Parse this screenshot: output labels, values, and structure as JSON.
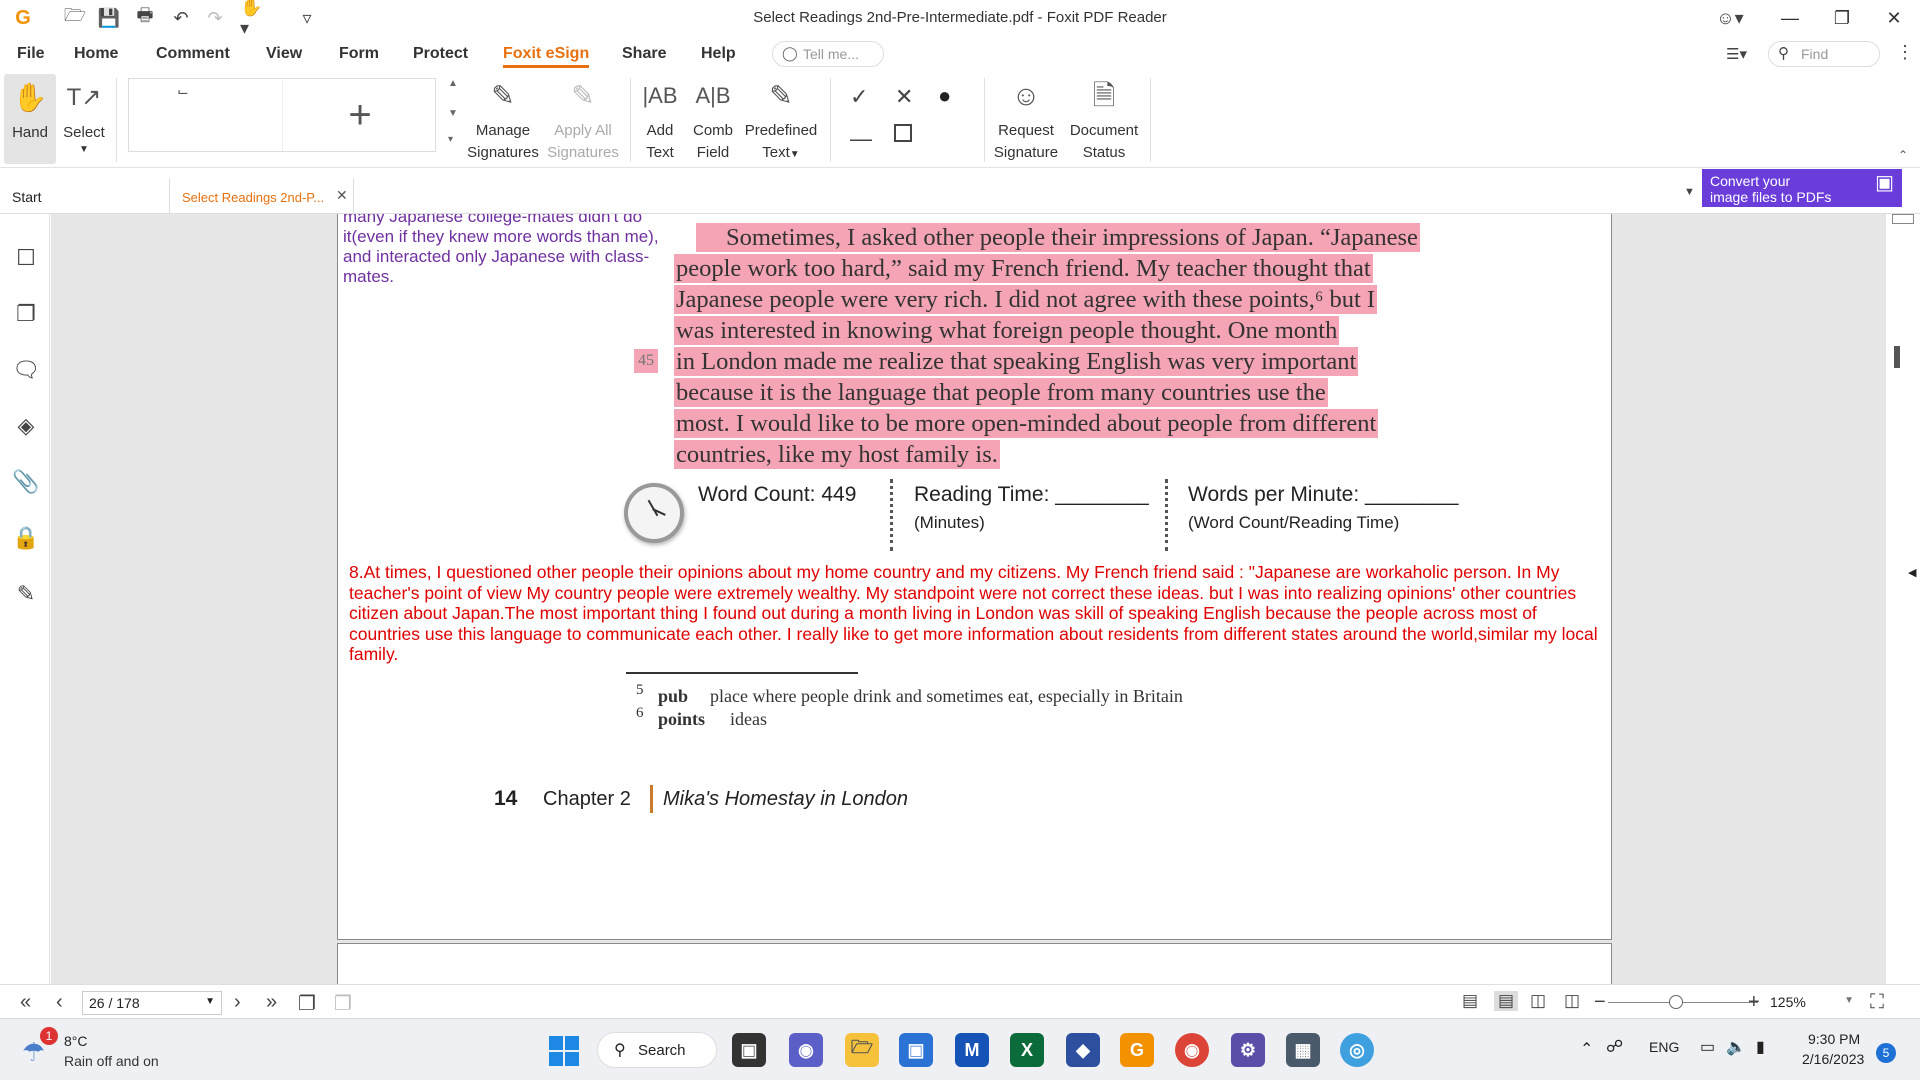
{
  "window": {
    "title": "Select Readings 2nd-Pre-Intermediate.pdf - Foxit PDF Reader",
    "minimize_icon": "minimize",
    "maximize_icon": "restore",
    "close_icon": "close"
  },
  "menu": {
    "items": [
      "File",
      "Home",
      "Comment",
      "View",
      "Form",
      "Protect",
      "Foxit eSign",
      "Share",
      "Help"
    ],
    "active": "Foxit eSign",
    "tell_me_placeholder": "Tell me...",
    "find_placeholder": "Find"
  },
  "ribbon": {
    "hand": "Hand",
    "select": "Select",
    "manage_signatures": [
      "Manage",
      "Signatures"
    ],
    "apply_all_signatures": [
      "Apply All",
      "Signatures"
    ],
    "add_text": [
      "Add",
      "Text"
    ],
    "comb_field": [
      "Comb",
      "Field"
    ],
    "predefined_text": [
      "Predefined",
      "Text"
    ],
    "request_signature": [
      "Request",
      "Signature"
    ],
    "document_status": [
      "Document",
      "Status"
    ],
    "add_symbol": "+"
  },
  "tabs": {
    "start": "Start",
    "document": "Select Readings 2nd-P...",
    "promo": [
      "Convert your",
      "image files to PDFs"
    ]
  },
  "document": {
    "purple_note": "many Japanese college-mates didn't do it(even if they knew more words than me), and interacted only Japanese with class-mates.",
    "highlighted_lines": [
      "Sometimes, I asked other people their impressions of Japan. “Japanese",
      "people work too hard,” said my French friend. My teacher thought that",
      "Japanese people were very rich. I did not agree with these points,⁶ but I",
      "was interested in knowing what foreign people thought. One month",
      "in London made me realize that speaking English was very important",
      "because it is the language that people from many countries use the",
      "most. I would like to be more open-minded about people from different",
      "countries, like my host family is."
    ],
    "line_number": "45",
    "word_count": "Word Count: 449",
    "reading_time": "Reading Time: ________",
    "reading_time_unit": "(Minutes)",
    "words_per_minute": "Words per Minute: ________",
    "wpm_formula": "(Word Count/Reading Time)",
    "red_note": "8.At times, I questioned other people their opinions about my home country and my citizens. My French friend said : \"Japanese are workaholic person. In My teacher's  point of view My country people were extremely wealthy. My standpoint were not correct these ideas. but I was into realizing opinions' other countries citizen about Japan.The most important thing I found out during a month living in London was skill of speaking English because the people across most of countries use this language to communicate each other. I really like to get more information about residents from different states around the world,similar my local family.",
    "footnotes": [
      {
        "num": "5",
        "term": "pub",
        "def": "place where people drink and sometimes eat, especially in Britain"
      },
      {
        "num": "6",
        "term": "points",
        "def": "ideas"
      }
    ],
    "footer_page": "14",
    "footer_chapter": "Chapter 2",
    "footer_title": "Mika's Homestay in London"
  },
  "status": {
    "page_indicator": "26 / 178",
    "zoom": "125%",
    "zoom_level": 0.45
  },
  "taskbar": {
    "weather_temp": "8°C",
    "weather_desc": "Rain off and on",
    "weather_badge": "1",
    "search": "Search",
    "language": "ENG",
    "time": "9:30 PM",
    "date": "2/16/2023",
    "notification_count": "5"
  }
}
